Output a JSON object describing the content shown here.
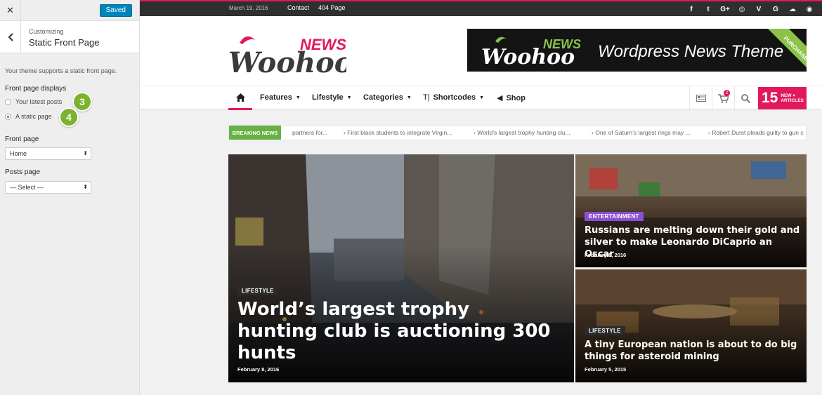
{
  "customizer": {
    "close_icon": "close-icon",
    "saved_label": "Saved",
    "customizing_label": "Customizing",
    "section_title": "Static Front Page",
    "description": "Your theme supports a static front page.",
    "front_page_displays_label": "Front page displays",
    "options": [
      {
        "label": "Your latest posts",
        "selected": false
      },
      {
        "label": "A static page",
        "selected": true
      }
    ],
    "step_markers": [
      "3",
      "4"
    ],
    "front_page_label": "Front page",
    "front_page_value": "Home",
    "posts_page_label": "Posts page",
    "posts_page_value": "— Select —"
  },
  "site": {
    "topbar": {
      "date": "March 19, 2016",
      "links": [
        "Contact",
        "404 Page"
      ],
      "social_icons": [
        "facebook-icon",
        "twitter-icon",
        "google-plus-icon",
        "dribbble-icon",
        "vimeo-icon",
        "google-icon",
        "soundcloud-icon",
        "rss-icon"
      ],
      "social_glyphs": [
        "f",
        "t",
        "G+",
        "◎",
        "V",
        "G",
        "☁",
        "◉"
      ]
    },
    "logo": {
      "word": "Woohoo",
      "badge": "NEWS"
    },
    "banner": {
      "logo_word": "Woohoo",
      "logo_badge": "NEWS",
      "tagline": "Wordpress News Theme",
      "ribbon": "PURCHASE"
    },
    "nav": {
      "items": [
        "Features",
        "Lifestyle",
        "Categories",
        "Shortcodes",
        "Shop"
      ],
      "cart_count": "2",
      "new_count": "15",
      "new_label_1": "NEW",
      "new_label_2": "ARTICLES"
    },
    "ticker": {
      "label": "BREAKING NEWS",
      "items": [
        "partners for...",
        "First black students to integrate Virgin...",
        "World’s largest trophy hunting clu...",
        "One of Saturn’s largest rings may ...",
        "Robert Durst pleads guilty to gun c"
      ]
    },
    "cards": [
      {
        "category": "LIFESTYLE",
        "title": "World’s largest trophy hunting club is auctioning 300 hunts",
        "date": "February 8, 2016",
        "badge_color": "#2b2b2b"
      },
      {
        "category": "ENTERTAINMENT",
        "title": "Russians are melting down their gold and silver to make Leonardo DiCaprio an Oscar",
        "date": "February 8, 2016",
        "badge_color": "#8a4fd6"
      },
      {
        "category": "LIFESTYLE",
        "title": "A tiny European nation is about to do big things for asteroid mining",
        "date": "February 5, 2015",
        "badge_color": "#2b2b2b"
      }
    ],
    "accent_color": "#e2185d"
  }
}
